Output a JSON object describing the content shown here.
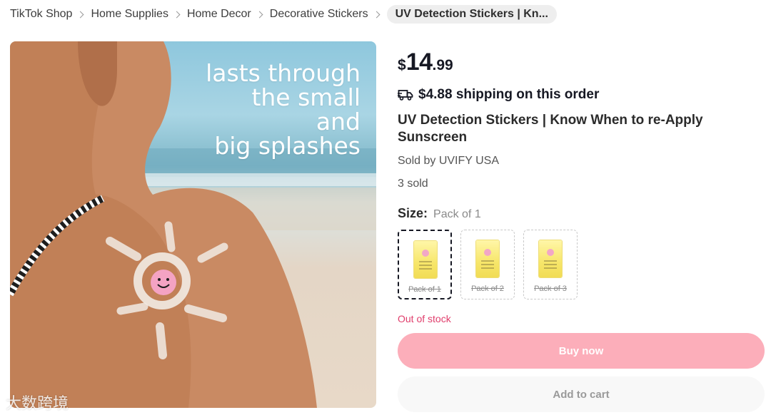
{
  "breadcrumb": {
    "items": [
      "TikTok Shop",
      "Home Supplies",
      "Home Decor",
      "Decorative Stickers"
    ],
    "current": "UV Detection Stickers | Kn..."
  },
  "hero": {
    "caption": [
      "lasts through",
      "the small",
      "and",
      "big splashes"
    ],
    "watermark": "大数跨境"
  },
  "product": {
    "price": {
      "currency": "$",
      "whole": "14",
      "decimal": ".99"
    },
    "shipping": "$4.88 shipping on this order",
    "title": "UV Detection Stickers | Know When to re-Apply Sunscreen",
    "seller": "Sold by UVIFY USA",
    "sold": "3 sold"
  },
  "size": {
    "label": "Size:",
    "selected_value": "Pack of 1",
    "options": [
      "Pack of 1",
      "Pack of 2",
      "Pack of 3"
    ]
  },
  "status": {
    "stock": "Out of stock"
  },
  "actions": {
    "buy_now": "Buy now",
    "add_to_cart": "Add to cart"
  },
  "colors": {
    "buy_button": "#fcaeba",
    "stock_text": "#e03e6c",
    "cart_button": "#f8f8f8"
  }
}
